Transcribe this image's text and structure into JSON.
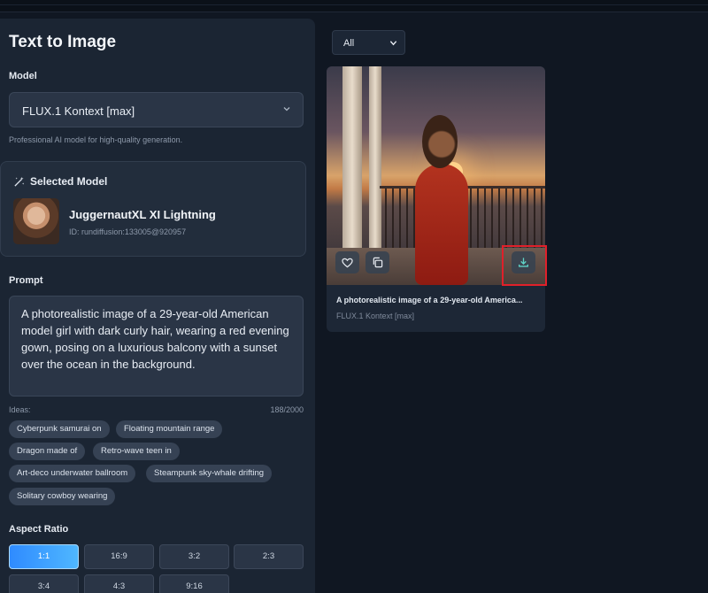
{
  "page": {
    "title": "Text to Image"
  },
  "model": {
    "label": "Model",
    "value": "FLUX.1 Kontext [max]",
    "hint": "Professional AI model for high-quality generation."
  },
  "selected_model": {
    "header": "Selected Model",
    "name": "JuggernautXL XI Lightning",
    "id": "ID: rundiffusion:133005@920957"
  },
  "prompt": {
    "label": "Prompt",
    "value": "A photorealistic image of a 29-year-old American model girl with dark curly hair, wearing a red evening gown, posing on a luxurious balcony with a sunset over the ocean in the background.",
    "ideas_label": "Ideas:",
    "char_count": "188/2000"
  },
  "ideas": [
    "Cyberpunk samurai on",
    "Floating mountain range",
    "Dragon made of",
    "Retro-wave teen in",
    "Art-deco underwater ballroom",
    "Steampunk sky-whale drifting",
    "Solitary cowboy wearing"
  ],
  "aspect_ratio": {
    "label": "Aspect Ratio",
    "options": [
      "1:1",
      "16:9",
      "3:2",
      "2:3",
      "3:4",
      "4:3",
      "9:16"
    ],
    "selected": "1:1"
  },
  "filter": {
    "value": "All"
  },
  "gallery": {
    "items": [
      {
        "title": "A photorealistic image of a 29-year-old America...",
        "model": "FLUX.1 Kontext [max]"
      }
    ]
  },
  "colors": {
    "accent": "#3ba3ff",
    "highlight": "#e0202a",
    "panel": "#1b2533",
    "background": "#101722"
  },
  "icons": {
    "model_select": "chevron-down-icon",
    "selected_header": "magic-wand-icon",
    "favorite": "heart-icon",
    "copy": "copy-icon",
    "download": "download-icon"
  }
}
